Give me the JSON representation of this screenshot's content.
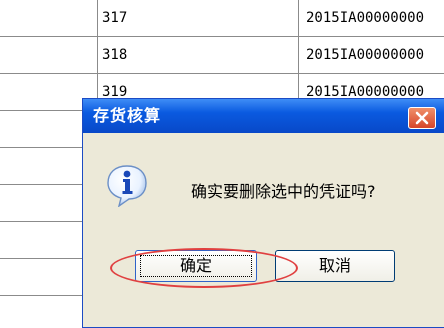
{
  "table": {
    "rows": [
      {
        "num": "317",
        "code": "2015IA00000000"
      },
      {
        "num": "318",
        "code": "2015IA00000000"
      },
      {
        "num": "319",
        "code": "2015IA00000000"
      },
      {
        "num": "",
        "code": ""
      },
      {
        "num": "",
        "code": ""
      },
      {
        "num": "",
        "code": ""
      },
      {
        "num": "",
        "code": ""
      },
      {
        "num": "",
        "code": ""
      }
    ]
  },
  "dialog": {
    "title": "存货核算",
    "message": "确实要删除选中的凭证吗?",
    "ok_label": "确定",
    "cancel_label": "取消",
    "icon": "info-icon",
    "close_icon": "close-icon"
  },
  "colors": {
    "titlebar": "#0a5ae0",
    "dialog_bg": "#ece9d8",
    "highlight_oval": "#e04040"
  }
}
